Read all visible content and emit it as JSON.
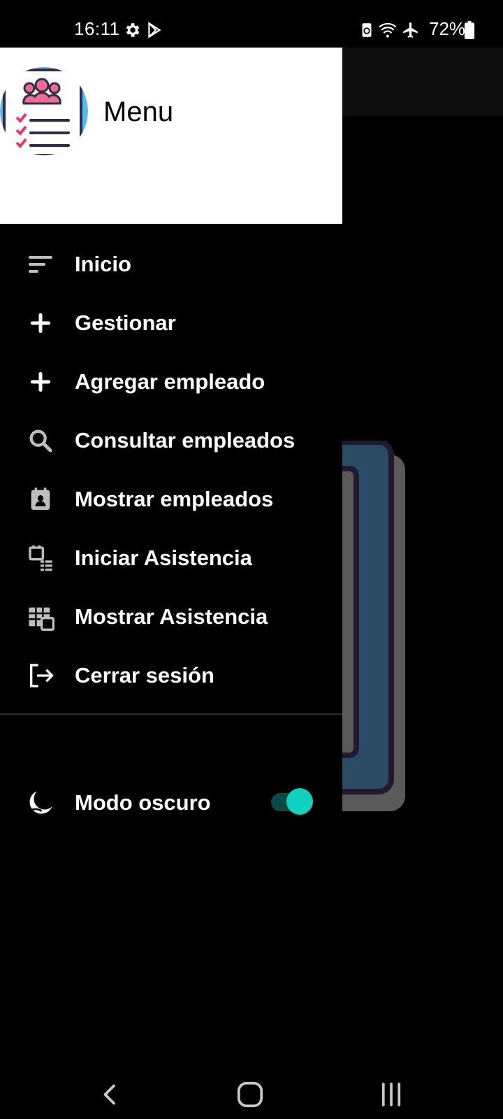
{
  "status_bar": {
    "time": "16:11",
    "battery_percent": "72%",
    "icons": [
      "settings-icon",
      "play-store-icon",
      "battery-saver-icon",
      "wifi-icon",
      "airplane-icon",
      "battery-icon"
    ]
  },
  "drawer": {
    "title": "Menu",
    "logo_icon": "employee-list-logo",
    "items": [
      {
        "label": "Inicio",
        "icon": "sort-lines-icon"
      },
      {
        "label": "Gestionar",
        "icon": "plus-icon"
      },
      {
        "label": "Agregar empleado",
        "icon": "plus-icon"
      },
      {
        "label": "Consultar empleados",
        "icon": "search-icon"
      },
      {
        "label": "Mostrar empleados",
        "icon": "contact-calendar-icon"
      },
      {
        "label": "Iniciar Asistencia",
        "icon": "checklist-calendar-icon"
      },
      {
        "label": "Mostrar Asistencia",
        "icon": "calendar-grid-icon"
      },
      {
        "label": "Cerrar sesión",
        "icon": "logout-icon"
      }
    ],
    "dark_mode": {
      "label": "Modo oscuro",
      "enabled": true,
      "icon": "moon-icon"
    }
  },
  "colors": {
    "accent": "#0fd1bd",
    "toggle_track": "#0b4a44",
    "drawer_header_bg": "#ffffff",
    "drawer_bg": "#000000"
  },
  "nav_bar": {
    "buttons": [
      "back-icon",
      "home-icon",
      "recents-icon"
    ]
  }
}
